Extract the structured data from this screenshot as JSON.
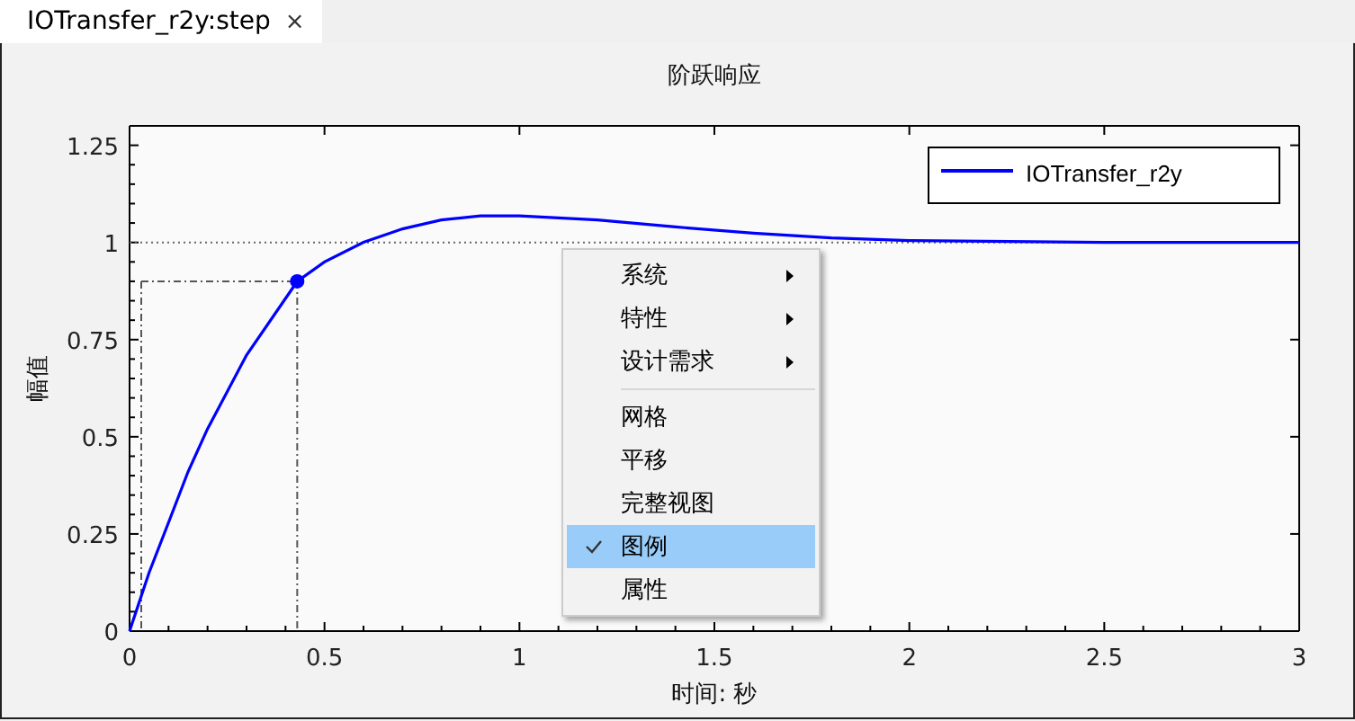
{
  "tab": {
    "label": "IOTransfer_r2y:step",
    "close": "×",
    "selected": true
  },
  "plot": {
    "chart_data": {
      "type": "line",
      "title": "阶跃响应",
      "xlabel": "时间: 秒",
      "ylabel": "幅值",
      "x": [
        0,
        0.05,
        0.1,
        0.15,
        0.2,
        0.3,
        0.43,
        0.5,
        0.6,
        0.7,
        0.8,
        0.9,
        1.0,
        1.2,
        1.4,
        1.6,
        1.8,
        2.0,
        2.5,
        3.0
      ],
      "series": [
        {
          "name": "IOTransfer_r2y",
          "color": "#0000ff",
          "values": [
            0,
            0.15,
            0.28,
            0.41,
            0.52,
            0.71,
            0.9,
            0.95,
            1.0,
            1.035,
            1.058,
            1.068,
            1.068,
            1.058,
            1.04,
            1.024,
            1.012,
            1.005,
            1.0,
            1.0
          ]
        }
      ],
      "xlim": [
        0,
        3
      ],
      "ylim": [
        0,
        1.3
      ],
      "xticks": [
        0,
        0.5,
        1,
        1.5,
        2,
        2.5,
        3
      ],
      "yticks": [
        0,
        0.25,
        0.5,
        0.75,
        1,
        1.25
      ],
      "ref_lines": [
        {
          "axis": "y",
          "value": 1
        },
        {
          "axis": "x",
          "value": 0.03
        },
        {
          "axis": "y",
          "value": 0.9
        },
        {
          "axis": "x",
          "value": 0.43
        }
      ]
    },
    "legend": {
      "visible": true
    }
  },
  "context_menu": [
    {
      "kind": "submenu",
      "label": "系统",
      "checked": false,
      "selected": false
    },
    {
      "kind": "submenu",
      "label": "特性",
      "checked": false,
      "selected": false
    },
    {
      "kind": "submenu",
      "label": "设计需求",
      "checked": false,
      "selected": false
    },
    {
      "kind": "separator"
    },
    {
      "kind": "item",
      "label": "网格",
      "checked": false,
      "selected": false
    },
    {
      "kind": "item",
      "label": "平移",
      "checked": false,
      "selected": false
    },
    {
      "kind": "item",
      "label": "完整视图",
      "checked": false,
      "selected": false
    },
    {
      "kind": "item",
      "label": "图例",
      "checked": true,
      "selected": true
    },
    {
      "kind": "item",
      "label": "属性",
      "checked": false,
      "selected": false
    }
  ]
}
